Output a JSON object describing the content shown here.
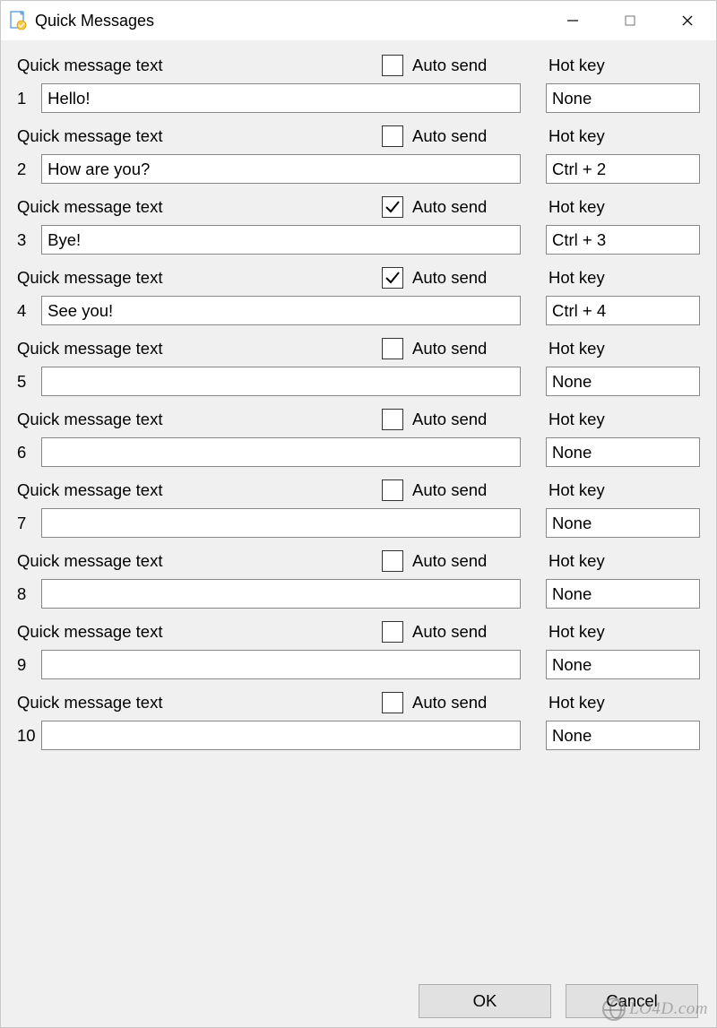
{
  "window": {
    "title": "Quick Messages"
  },
  "labels": {
    "message_text": "Quick message text",
    "auto_send": "Auto send",
    "hot_key": "Hot key"
  },
  "rows": [
    {
      "num": "1",
      "text": "Hello!",
      "auto_send": false,
      "hotkey": "None"
    },
    {
      "num": "2",
      "text": "How are you?",
      "auto_send": false,
      "hotkey": "Ctrl + 2"
    },
    {
      "num": "3",
      "text": "Bye!",
      "auto_send": true,
      "hotkey": "Ctrl + 3"
    },
    {
      "num": "4",
      "text": "See you!",
      "auto_send": true,
      "hotkey": "Ctrl + 4"
    },
    {
      "num": "5",
      "text": "",
      "auto_send": false,
      "hotkey": "None"
    },
    {
      "num": "6",
      "text": "",
      "auto_send": false,
      "hotkey": "None"
    },
    {
      "num": "7",
      "text": "",
      "auto_send": false,
      "hotkey": "None"
    },
    {
      "num": "8",
      "text": "",
      "auto_send": false,
      "hotkey": "None"
    },
    {
      "num": "9",
      "text": "",
      "auto_send": false,
      "hotkey": "None"
    },
    {
      "num": "10",
      "text": "",
      "auto_send": false,
      "hotkey": "None"
    }
  ],
  "buttons": {
    "ok": "OK",
    "cancel": "Cancel"
  },
  "watermark": "LO4D.com"
}
